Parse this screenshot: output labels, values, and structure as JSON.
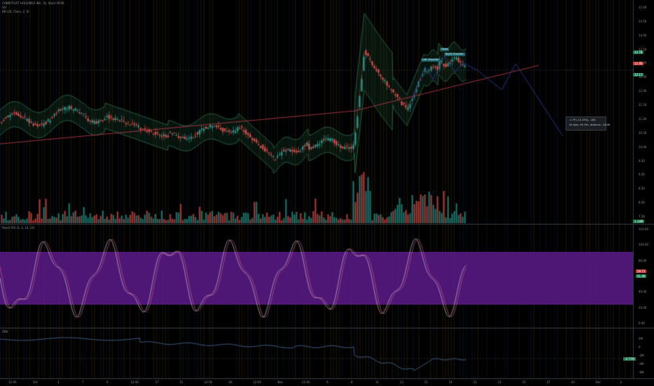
{
  "header": {
    "symbol_line": "CANNTRUST HOLDINGS INC, 1h, Stock NYSE",
    "volume_label": "Vol",
    "bb_label": "BB (20, Close, 2, 0)",
    "stoch_label": "Stoch RSI (3, 3, 14, 14)",
    "obv_label": "OBV"
  },
  "price_axis": {
    "ticks": [
      "15.00",
      "14.50",
      "14.00",
      "13.50",
      "13.00",
      "12.50",
      "12.00",
      "11.50",
      "11.00",
      "10.50",
      "10.00",
      "9.50",
      "9.00",
      "8.50",
      "8.00",
      "7.50"
    ],
    "current_price": "12.46",
    "bb_upper": "12.78",
    "bb_lower": "12.17",
    "volume_tag": "1.14M"
  },
  "stoch_axis": {
    "ticks": [
      "110.00",
      "100.00",
      "80.00",
      "60.00",
      "40.00",
      "20.00",
      "0.00"
    ],
    "k_value": "58.71",
    "d_value": "51.46"
  },
  "obv_axis": {
    "ticks": [
      "2M",
      "0",
      "-2M",
      "-4M",
      "-6M"
    ],
    "value": "-4.77M"
  },
  "time_axis": {
    "ticks": [
      "12:00",
      "Oct",
      "3",
      "7",
      "9",
      "12:00",
      "17",
      "21",
      "12:00",
      "28",
      "12:00",
      "Nov",
      "12:00",
      "6",
      "8",
      "11",
      "13",
      "15",
      "19",
      "21",
      "23",
      "25",
      "27",
      "30",
      "Dec",
      "3"
    ]
  },
  "pattern": {
    "left_shoulder": "Left Shoulder",
    "head": "Head",
    "right_shoulder": "Right Shoulder"
  },
  "measure_box": {
    "line1": "-1.79 (-12.35%), -180",
    "line2": "45 bars, 9d 19h, distance: -18.96"
  },
  "colors": {
    "up": "#26a69a",
    "down": "#ef5350",
    "bb": "#2e7d57",
    "trend": "#b03a48",
    "projection": "#2d3a9c",
    "stoch_band": "#5c1a8a",
    "obv": "#4a6f9c"
  }
}
